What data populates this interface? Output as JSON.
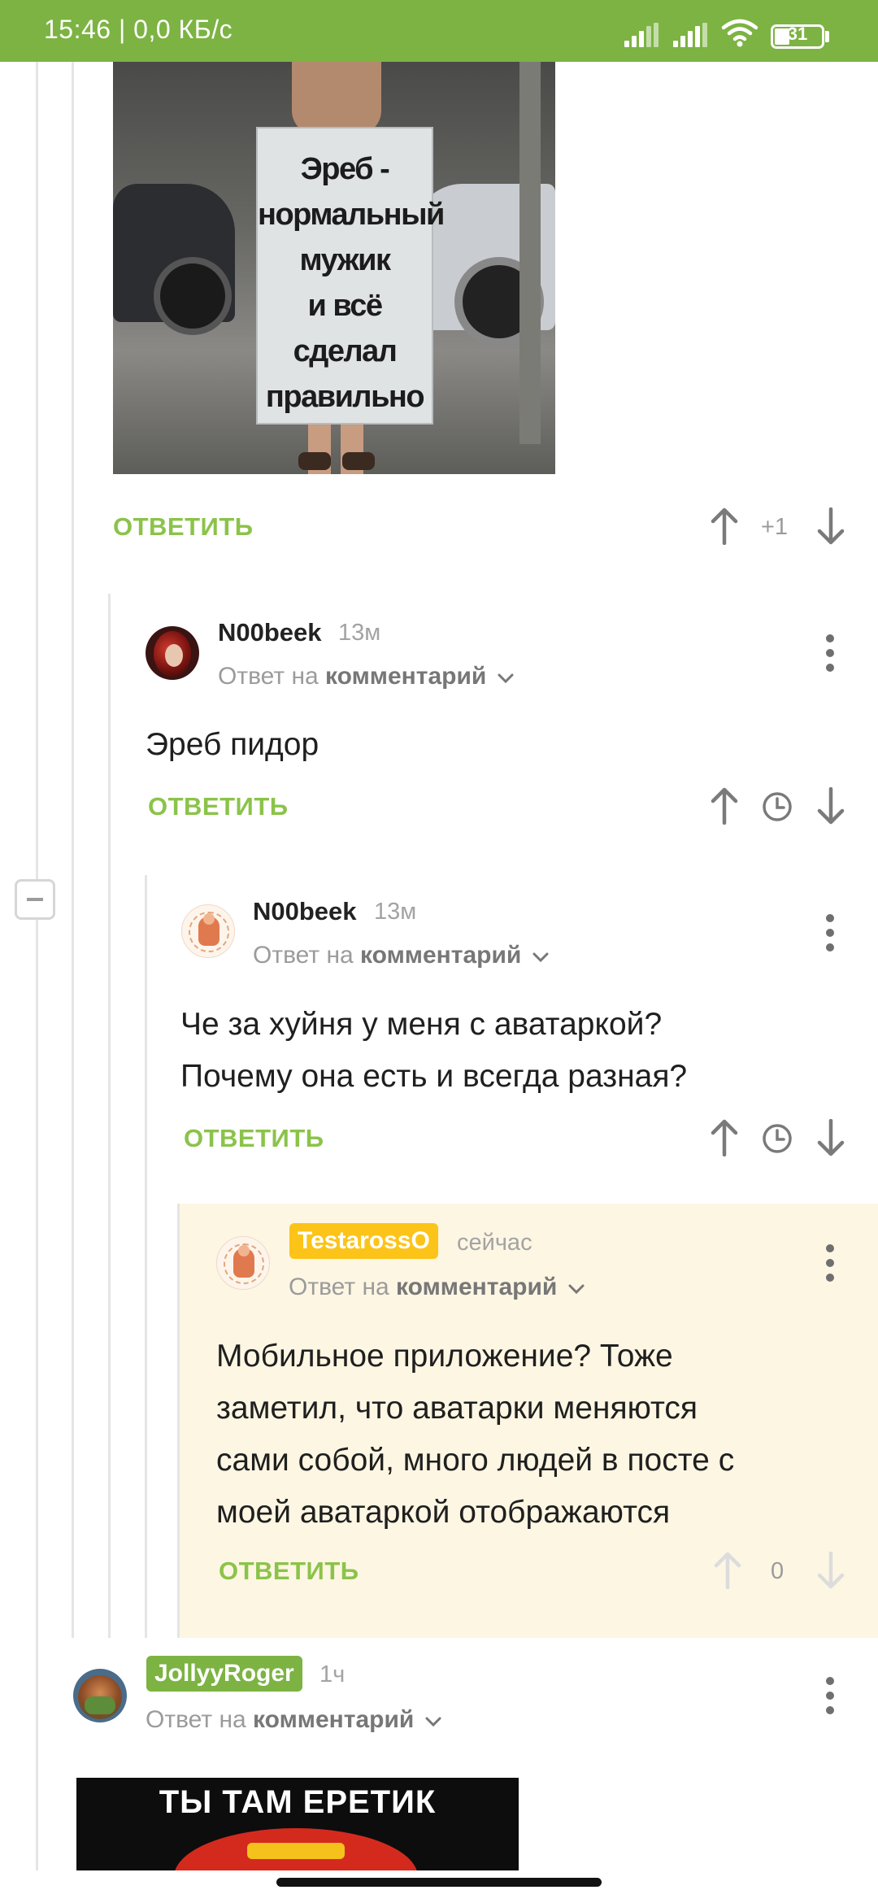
{
  "status_bar": {
    "time_speed": "15:46 | 0,0 КБ/с",
    "battery": "31"
  },
  "post_image": {
    "sign_lines": [
      "Эреб -",
      "нормальный",
      "мужик",
      "и всё сделал",
      "правильно"
    ]
  },
  "top_comment": {
    "reply_label": "ОТВЕТИТЬ",
    "rating": "+1"
  },
  "comments": [
    {
      "author": "N00beek",
      "time": "13м",
      "reply_to_prefix": "Ответ на",
      "reply_to_link": "комментарий",
      "text": "Эреб пидор",
      "reply_label": "ОТВЕТИТЬ"
    },
    {
      "author": "N00beek",
      "time": "13м",
      "reply_to_prefix": "Ответ на",
      "reply_to_link": "комментарий",
      "text_lines": [
        "Че за хуйня у меня с аватаркой?",
        "Почему она есть и всегда разная?"
      ],
      "reply_label": "ОТВЕТИТЬ"
    },
    {
      "author": "TestarossO",
      "time": "сейчас",
      "reply_to_prefix": "Ответ на",
      "reply_to_link": "комментарий",
      "text_lines": [
        "Мобильное приложение? Тоже",
        "заметил, что аватарки меняются",
        "сами собой, много людей в посте с",
        "моей аватаркой отображаются"
      ],
      "reply_label": "ОТВЕТИТЬ",
      "rating": "0"
    },
    {
      "author": "JollyyRoger",
      "time": "1ч",
      "reply_to_prefix": "Ответ на",
      "reply_to_link": "комментарий",
      "image_caption": "ТЫ ТАМ ЕРЕТИК"
    }
  ],
  "colors": {
    "brand_green": "#7cb342",
    "reply_green": "#8bc34a",
    "highlight_bg": "#fdf6e3",
    "badge_yellow": "#fcc419"
  }
}
